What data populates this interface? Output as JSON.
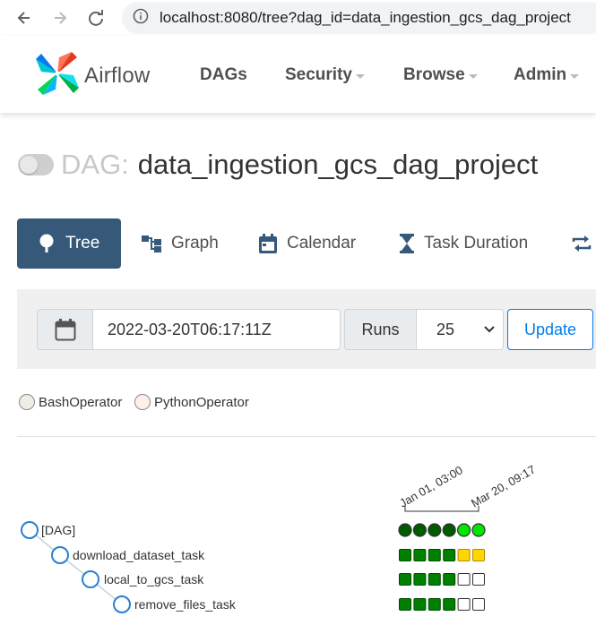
{
  "browser": {
    "url": "localhost:8080/tree?dag_id=data_ingestion_gcs_dag_project",
    "icons": [
      "back-arrow-icon",
      "forward-arrow-icon",
      "reload-icon",
      "info-icon"
    ]
  },
  "navbar": {
    "brand": "Airflow",
    "items": [
      {
        "label": "DAGs",
        "dropdown": false
      },
      {
        "label": "Security",
        "dropdown": true
      },
      {
        "label": "Browse",
        "dropdown": true
      },
      {
        "label": "Admin",
        "dropdown": true
      }
    ]
  },
  "dag": {
    "prefix": "DAG:",
    "id": "data_ingestion_gcs_dag_project",
    "paused": true
  },
  "tabs": [
    {
      "label": "Tree",
      "icon": "tree-icon",
      "active": true
    },
    {
      "label": "Graph",
      "icon": "graph-icon",
      "active": false
    },
    {
      "label": "Calendar",
      "icon": "calendar-icon",
      "active": false
    },
    {
      "label": "Task Duration",
      "icon": "hourglass-icon",
      "active": false
    },
    {
      "label": "",
      "icon": "retry-arrows-icon",
      "active": false
    }
  ],
  "controls": {
    "base_date": "2022-03-20T06:17:11Z",
    "runs_label": "Runs",
    "runs_value": "25",
    "update_label": "Update"
  },
  "legend": [
    {
      "label": "BashOperator",
      "color": "#f0ede4"
    },
    {
      "label": "PythonOperator",
      "color": "#ffefeb"
    }
  ],
  "tree": {
    "date_labels": [
      "Jan 01, 03:00",
      "Mar 20, 09:17"
    ],
    "nodes": [
      {
        "label": "[DAG]",
        "depth": 0,
        "runs": [
          "running",
          "running",
          "running",
          "running",
          "success_bright",
          "success_bright"
        ]
      },
      {
        "label": "download_dataset_task",
        "depth": 1,
        "runs": [
          "success",
          "success",
          "success",
          "success",
          "up_for_retry",
          "up_for_retry"
        ]
      },
      {
        "label": "local_to_gcs_task",
        "depth": 2,
        "runs": [
          "success",
          "success",
          "success",
          "success",
          "no_status",
          "no_status"
        ]
      },
      {
        "label": "remove_files_task",
        "depth": 3,
        "runs": [
          "success",
          "success",
          "success",
          "success",
          "no_status",
          "no_status"
        ]
      }
    ]
  },
  "colors": {
    "primary": "#36597a",
    "link": "#017cee",
    "success": "#008000",
    "running_fill": "#005a00",
    "success_bright": "#00e600",
    "up_for_retry": "#ffd700",
    "node_stroke": "#2a7fd4"
  }
}
